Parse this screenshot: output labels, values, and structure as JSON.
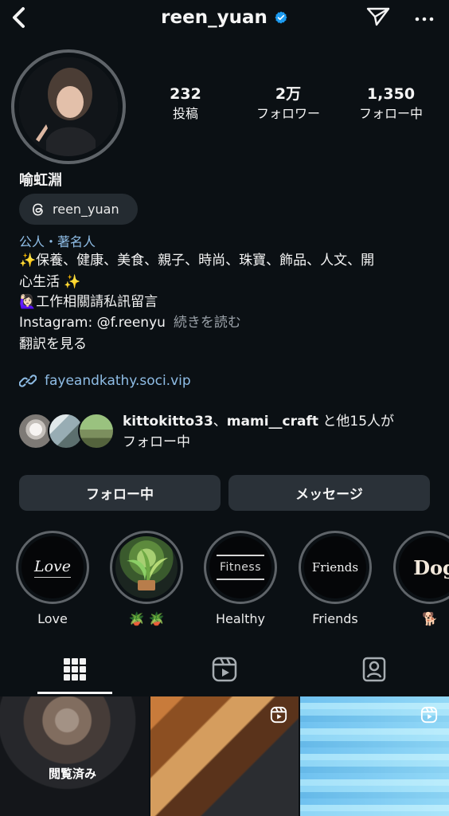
{
  "header": {
    "username": "reen_yuan",
    "back_icon": "chevron-left-icon",
    "verified_icon": "verified-badge-icon",
    "share_icon": "paper-plane-icon",
    "more_icon": "more-horizontal-icon"
  },
  "profile": {
    "avatar_icon": "profile-photo",
    "stats": {
      "posts_count": "232",
      "posts_label": "投稿",
      "followers_count": "2万",
      "followers_label": "フォロワー",
      "following_count": "1,350",
      "following_label": "フォロー中"
    },
    "display_name": "喻虹淵",
    "threads_handle": "reen_yuan",
    "category": "公人・著名人",
    "bio": {
      "line1": "✨保養、健康、美食、親子、時尚、珠寶、飾品、人文、開",
      "line2": "心生活 ✨",
      "line3": "🙋🏻‍♀️工作相關請私訊留言",
      "line4": "Instagram: @f.reenyu",
      "read_more": "続きを読む",
      "translate": "翻訳を見る"
    },
    "link": "fayeandkathy.soci.vip"
  },
  "mutual": {
    "user1": "kittokitto33",
    "separator": "、",
    "user2": "mami__craft",
    "tail1": " と他",
    "count": "15",
    "tail2": "人が",
    "line2": "フォロー中"
  },
  "actions": {
    "following_button": "フォロー中",
    "message_button": "メッセージ"
  },
  "highlights": [
    {
      "label": "Love",
      "cover_text": "Love"
    },
    {
      "label": "🪴 🪴",
      "cover_text": ""
    },
    {
      "label": "Healthy",
      "cover_text": "Fitness"
    },
    {
      "label": "Friends",
      "cover_text": "Friends"
    },
    {
      "label": "🐕",
      "cover_text": "Dog"
    }
  ],
  "tabs": {
    "grid_icon": "grid-icon",
    "reels_icon": "reels-icon",
    "tagged_icon": "tagged-user-icon"
  },
  "grid": {
    "seen_label": "閲覧済み",
    "reel_badge_icon": "reel-badge-icon"
  },
  "colors": {
    "background": "#0b1014",
    "accent_link": "#8fbde6",
    "button_bg": "#2a3138",
    "verified_blue": "#1d9bf0"
  }
}
